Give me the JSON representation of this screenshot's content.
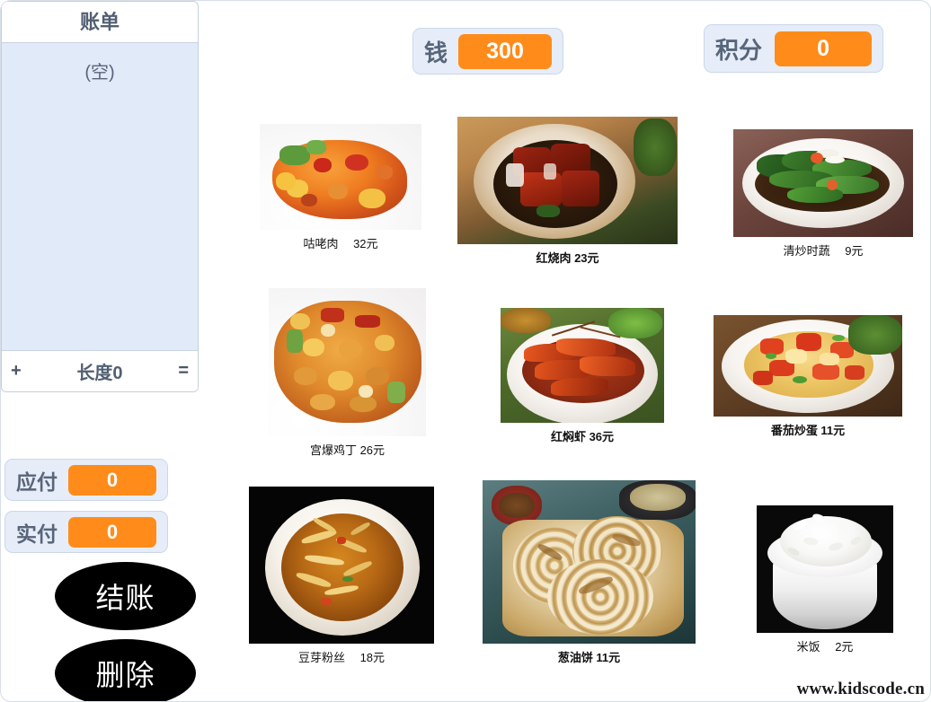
{
  "app": {
    "watermark": "www.kidscode.cn"
  },
  "bill_list": {
    "title": "账单",
    "empty_text": "(空)",
    "add_label": "+",
    "length_label": "长度0",
    "resize_label": "="
  },
  "monitors": {
    "money": {
      "label": "钱",
      "value": "300"
    },
    "points": {
      "label": "积分",
      "value": "0"
    },
    "due": {
      "label": "应付",
      "value": "0"
    },
    "paid": {
      "label": "实付",
      "value": "0"
    }
  },
  "buttons": {
    "checkout": "结账",
    "delete": "删除"
  },
  "colors": {
    "monitor_bg": "#e6edf8",
    "monitor_border": "#cbd7ea",
    "value_badge": "#ff8c1a",
    "label_text": "#58657a",
    "list_body": "#e0eaf9",
    "button_bg": "#000000"
  },
  "menu": {
    "items": [
      {
        "name": "咕咾肉",
        "price": 32,
        "currency": "元",
        "label": "咕咾肉　 32元"
      },
      {
        "name": "红烧肉",
        "price": 23,
        "currency": "元",
        "label": "红烧肉 23元"
      },
      {
        "name": "清炒时蔬",
        "price": 9,
        "currency": "元",
        "label": "清炒时蔬　 9元"
      },
      {
        "name": "宫爆鸡丁",
        "price": 26,
        "currency": "元",
        "label": "宫爆鸡丁 26元"
      },
      {
        "name": "红焖虾",
        "price": 36,
        "currency": "元",
        "label": "红焖虾 36元"
      },
      {
        "name": "番茄炒蛋",
        "price": 11,
        "currency": "元",
        "label": "番茄炒蛋 11元"
      },
      {
        "name": "豆芽粉丝",
        "price": 18,
        "currency": "元",
        "label": "豆芽粉丝　 18元"
      },
      {
        "name": "葱油饼",
        "price": 11,
        "currency": "元",
        "label": "葱油饼 11元"
      },
      {
        "name": "米饭",
        "price": 2,
        "currency": "元",
        "label": "米饭　 2元"
      }
    ]
  }
}
